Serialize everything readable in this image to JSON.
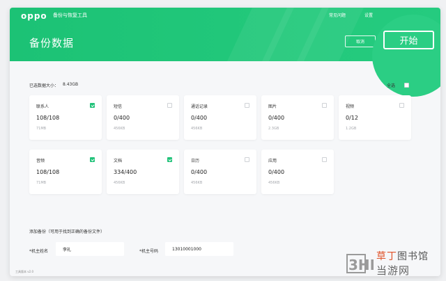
{
  "header": {
    "logo": "oppo",
    "app_title": "备份与恢复工具",
    "links": [
      "常见问题",
      "设置"
    ],
    "page_title": "备份数据",
    "cancel_label": "取消",
    "start_label": "开始"
  },
  "selection": {
    "selected_size_label": "已选数据大小：",
    "selected_size_value": "8.43GB",
    "select_all_label": "全选",
    "select_all_checked": false
  },
  "cards": [
    {
      "name": "联系人",
      "count": "108/108",
      "size": "71MB",
      "checked": true
    },
    {
      "name": "短信",
      "count": "0/400",
      "size": "456KB",
      "checked": false
    },
    {
      "name": "通话记录",
      "count": "0/400",
      "size": "456KB",
      "checked": false
    },
    {
      "name": "图片",
      "count": "0/400",
      "size": "2.3GB",
      "checked": false
    },
    {
      "name": "视频",
      "count": "0/12",
      "size": "1.2GB",
      "checked": false
    },
    {
      "name": "音频",
      "count": "108/108",
      "size": "71MB",
      "checked": true
    },
    {
      "name": "文档",
      "count": "334/400",
      "size": "456KB",
      "checked": true
    },
    {
      "name": "日历",
      "count": "0/400",
      "size": "456KB",
      "checked": false
    },
    {
      "name": "应用",
      "count": "0/400",
      "size": "456KB",
      "checked": false
    }
  ],
  "add_backup": {
    "label": "添加备份（可用于找到正确的备份文件）",
    "owner_name_label": "*机主姓名",
    "owner_name_value": "李礼",
    "owner_phone_label": "*机主号码",
    "owner_phone_value": "13010001000"
  },
  "version": "工具版本 v2.0",
  "watermark": {
    "line1_accent": "草丁",
    "line1_rest": "图书馆",
    "line2_brand": "3HE",
    "line2_text": "当游网"
  },
  "colors": {
    "header_green": "#22c87b",
    "checkbox_green": "#22c27a"
  }
}
